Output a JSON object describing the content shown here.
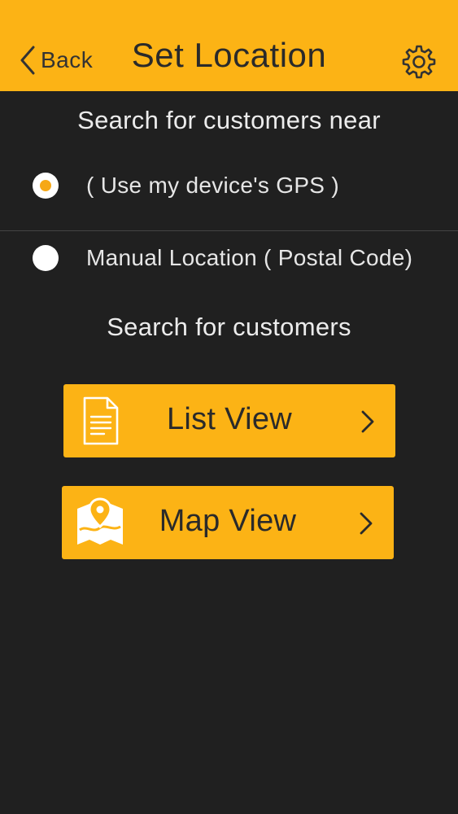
{
  "header": {
    "back_label": "Back",
    "title": "Set Location",
    "settings_icon": "gear-icon"
  },
  "location": {
    "heading": "Search for customers near",
    "options": [
      {
        "label": "( Use my device's GPS )",
        "selected": true
      },
      {
        "label": "Manual Location ( Postal Code)",
        "selected": false
      }
    ]
  },
  "search": {
    "heading": "Search for customers",
    "buttons": [
      {
        "label": "List View",
        "icon": "document-icon"
      },
      {
        "label": "Map View",
        "icon": "map-pin-icon"
      }
    ]
  },
  "colors": {
    "accent": "#FCB315",
    "background": "#202020",
    "radio_selected_dot": "#F6A816"
  }
}
